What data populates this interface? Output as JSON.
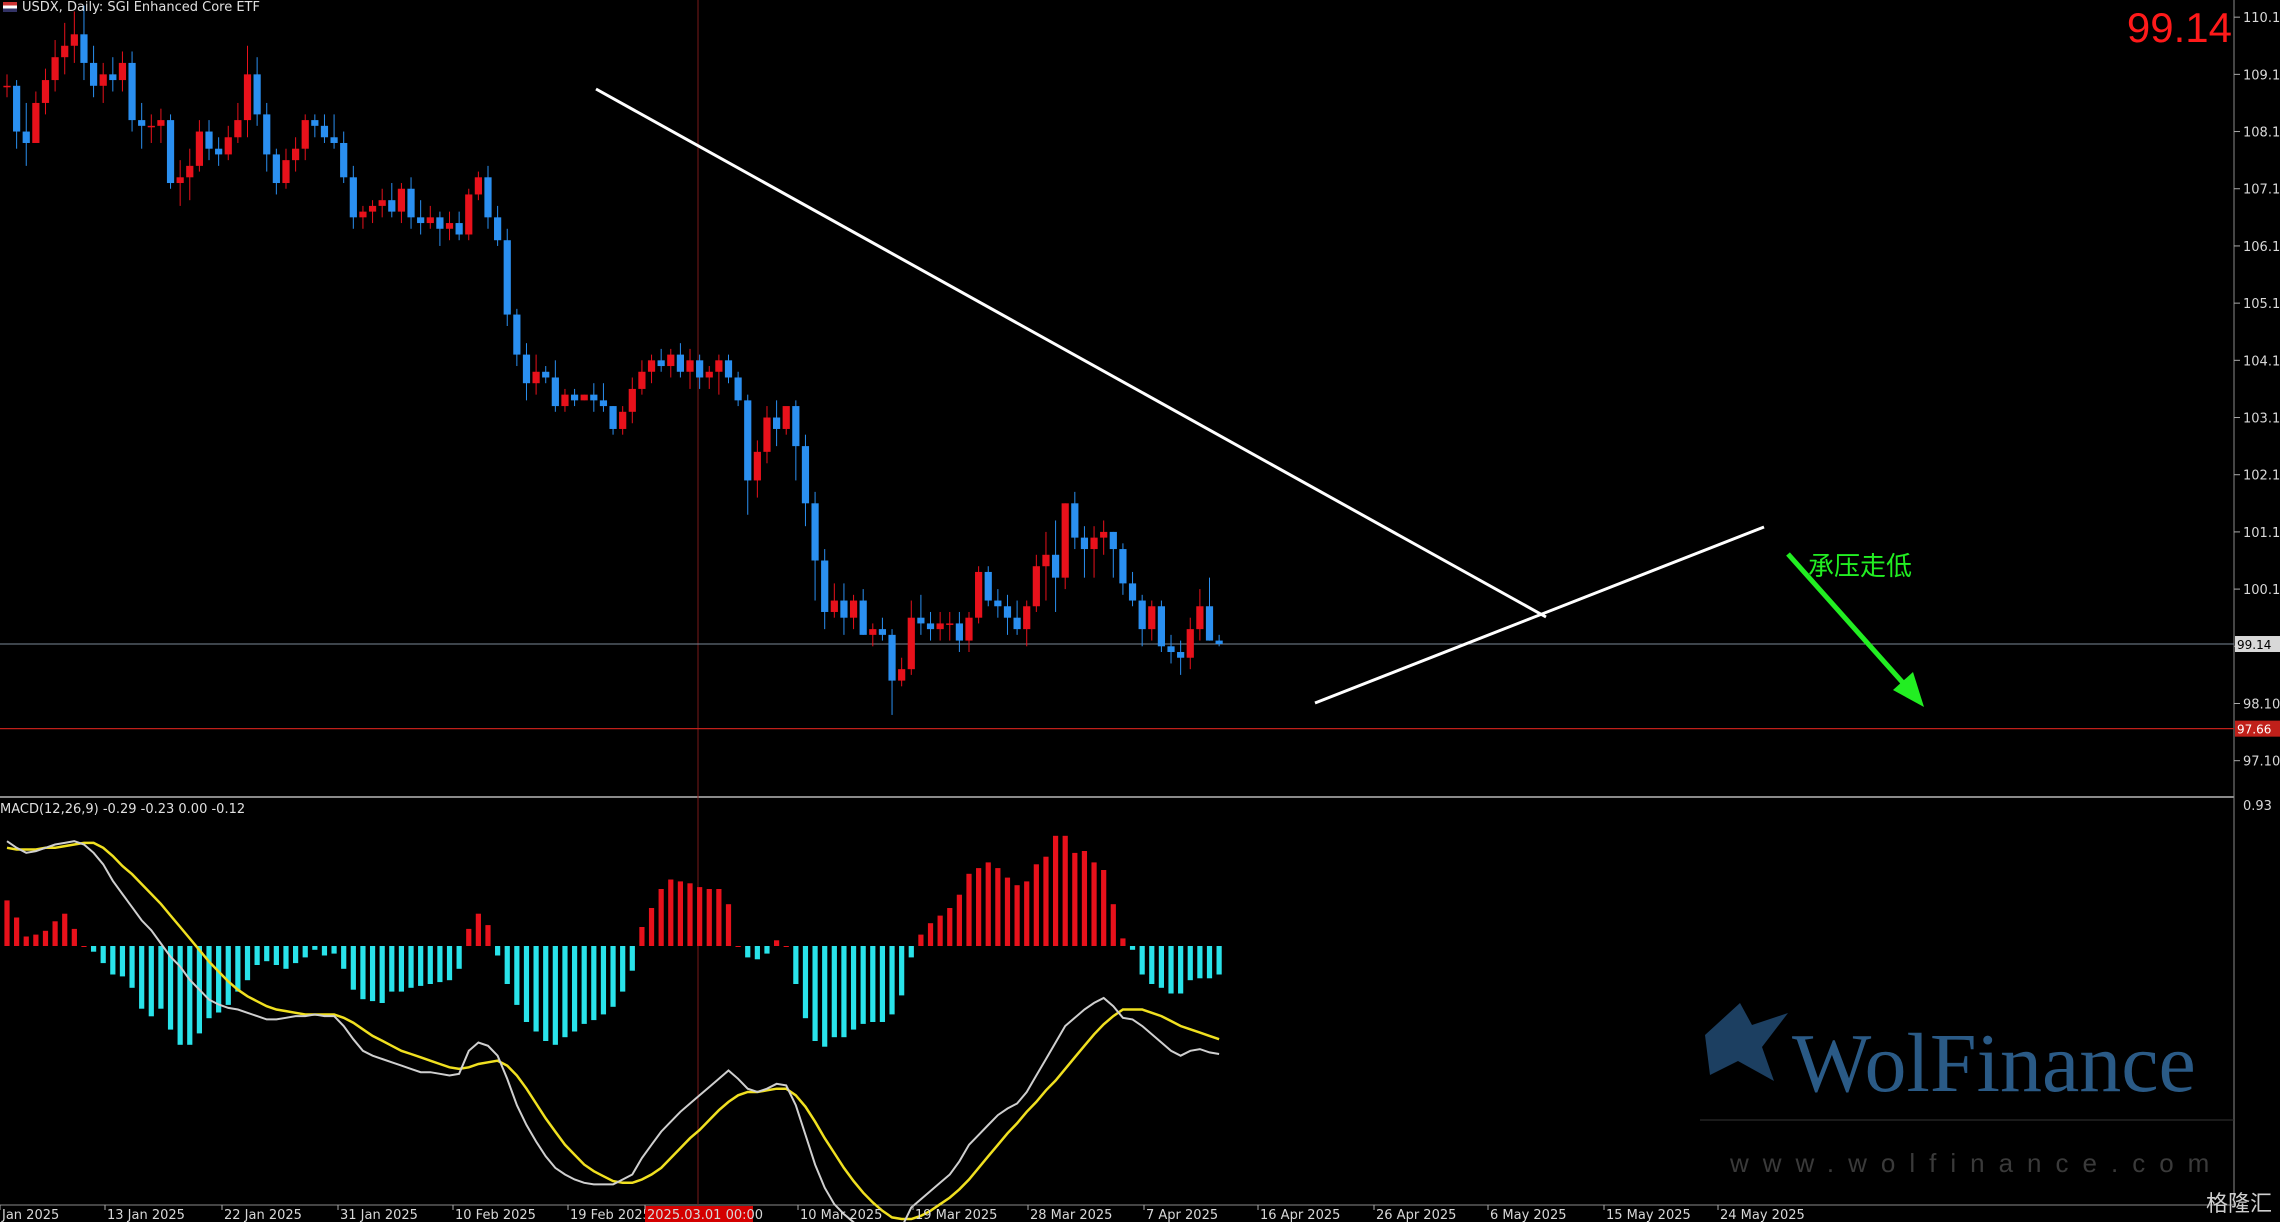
{
  "header": {
    "symbol_line": "USDX, Daily:  SGI Enhanced Core ETF",
    "current_price_big": "99.14",
    "macd_label": "MACD(12,26,9) -0.29 -0.23 0.00 -0.12",
    "macd_top_tick": "0.93"
  },
  "annotation": {
    "text": "承压走低",
    "color": "#22ee22"
  },
  "watermark": {
    "brand": "WolFinance",
    "url": "www.wolfinance.com"
  },
  "corner_brand": "格隆汇",
  "colors": {
    "up": "#e8111b",
    "down": "#2a8ff0",
    "hist_pos": "#e8111b",
    "hist_neg": "#29e3ea",
    "macd_line": "#cfcfcf",
    "signal_line": "#f0e020",
    "trendline": "#ffffff",
    "support_line": "#c0201a",
    "price_line": "#7a8796"
  },
  "chart_data": {
    "type": "candlestick",
    "y_ticks": [
      "110.10",
      "109.10",
      "108.10",
      "107.10",
      "106.10",
      "105.10",
      "104.10",
      "103.10",
      "102.10",
      "101.10",
      "100.10",
      "99.10",
      "98.10",
      "97.10"
    ],
    "price_tag": "99.14",
    "support_tag": "97.66",
    "support_level": 97.66,
    "ylim": [
      96.5,
      110.4
    ],
    "x_labels": [
      "Jan 2025",
      "13 Jan 2025",
      "22 Jan 2025",
      "31 Jan 2025",
      "10 Feb 2025",
      "19 Feb 2025",
      "2025.03.01 00:00",
      "10 Mar 2025",
      "19 Mar 2025",
      "28 Mar 2025",
      "7 Apr 2025",
      "16 Apr 2025",
      "26 Apr 2025",
      "6 May 2025",
      "15 May 2025",
      "24 May 2025"
    ],
    "candles": [
      [
        108.9,
        109.1,
        108.7,
        108.9
      ],
      [
        108.9,
        109.0,
        107.8,
        108.1
      ],
      [
        108.1,
        108.6,
        107.5,
        107.9
      ],
      [
        107.9,
        108.8,
        107.9,
        108.6
      ],
      [
        108.6,
        109.2,
        108.4,
        109.0
      ],
      [
        109.0,
        109.7,
        108.8,
        109.4
      ],
      [
        109.4,
        110.0,
        109.1,
        109.6
      ],
      [
        109.6,
        110.2,
        109.3,
        109.8
      ],
      [
        109.8,
        110.3,
        109.0,
        109.3
      ],
      [
        109.3,
        109.6,
        108.7,
        108.9
      ],
      [
        108.9,
        109.3,
        108.6,
        109.1
      ],
      [
        109.1,
        109.4,
        108.8,
        109.0
      ],
      [
        109.0,
        109.5,
        108.8,
        109.3
      ],
      [
        109.3,
        109.5,
        108.1,
        108.3
      ],
      [
        108.3,
        108.6,
        107.8,
        108.2
      ],
      [
        108.2,
        108.4,
        107.9,
        108.2
      ],
      [
        108.2,
        108.5,
        107.9,
        108.3
      ],
      [
        108.3,
        108.4,
        107.1,
        107.2
      ],
      [
        107.2,
        107.6,
        106.8,
        107.3
      ],
      [
        107.3,
        107.8,
        106.9,
        107.5
      ],
      [
        107.5,
        108.3,
        107.4,
        108.1
      ],
      [
        108.1,
        108.3,
        107.6,
        107.8
      ],
      [
        107.8,
        108.0,
        107.5,
        107.7
      ],
      [
        107.7,
        108.2,
        107.6,
        108.0
      ],
      [
        108.0,
        108.6,
        107.9,
        108.3
      ],
      [
        108.3,
        109.6,
        108.0,
        109.1
      ],
      [
        109.1,
        109.4,
        108.2,
        108.4
      ],
      [
        108.4,
        108.6,
        107.4,
        107.7
      ],
      [
        107.7,
        107.8,
        107.0,
        107.2
      ],
      [
        107.2,
        107.8,
        107.1,
        107.6
      ],
      [
        107.6,
        108.0,
        107.4,
        107.8
      ],
      [
        107.8,
        108.4,
        107.6,
        108.3
      ],
      [
        108.3,
        108.4,
        108.0,
        108.2
      ],
      [
        108.2,
        108.4,
        107.9,
        108.0
      ],
      [
        108.0,
        108.4,
        107.8,
        107.9
      ],
      [
        107.9,
        108.1,
        107.2,
        107.3
      ],
      [
        107.3,
        107.5,
        106.4,
        106.6
      ],
      [
        106.6,
        106.8,
        106.4,
        106.7
      ],
      [
        106.7,
        106.9,
        106.5,
        106.8
      ],
      [
        106.8,
        107.1,
        106.6,
        106.9
      ],
      [
        106.9,
        107.2,
        106.6,
        106.7
      ],
      [
        106.7,
        107.2,
        106.5,
        107.1
      ],
      [
        107.1,
        107.3,
        106.4,
        106.6
      ],
      [
        106.6,
        106.9,
        106.3,
        106.5
      ],
      [
        106.5,
        106.8,
        106.4,
        106.6
      ],
      [
        106.6,
        106.7,
        106.1,
        106.4
      ],
      [
        106.4,
        106.7,
        106.2,
        106.5
      ],
      [
        106.5,
        106.7,
        106.2,
        106.3
      ],
      [
        106.3,
        107.1,
        106.2,
        107.0
      ],
      [
        107.0,
        107.4,
        106.9,
        107.3
      ],
      [
        107.3,
        107.5,
        106.4,
        106.6
      ],
      [
        106.6,
        106.8,
        106.1,
        106.2
      ],
      [
        106.2,
        106.4,
        104.7,
        104.9
      ],
      [
        104.9,
        105.0,
        104.0,
        104.2
      ],
      [
        104.2,
        104.4,
        103.4,
        103.7
      ],
      [
        103.7,
        104.2,
        103.5,
        103.9
      ],
      [
        103.9,
        104.0,
        103.7,
        103.8
      ],
      [
        103.8,
        104.1,
        103.2,
        103.3
      ],
      [
        103.3,
        103.6,
        103.2,
        103.5
      ],
      [
        103.5,
        103.6,
        103.3,
        103.4
      ],
      [
        103.4,
        103.5,
        103.4,
        103.5
      ],
      [
        103.5,
        103.7,
        103.2,
        103.4
      ],
      [
        103.4,
        103.7,
        103.2,
        103.3
      ],
      [
        103.3,
        103.3,
        102.8,
        102.9
      ],
      [
        102.9,
        103.3,
        102.8,
        103.2
      ],
      [
        103.2,
        103.8,
        103.0,
        103.6
      ],
      [
        103.6,
        104.1,
        103.5,
        103.9
      ],
      [
        103.9,
        104.2,
        103.7,
        104.1
      ],
      [
        104.1,
        104.3,
        103.9,
        104.0
      ],
      [
        104.0,
        104.3,
        103.8,
        104.2
      ],
      [
        104.2,
        104.4,
        103.8,
        103.9
      ],
      [
        103.9,
        104.3,
        103.6,
        104.1
      ],
      [
        104.1,
        104.2,
        103.6,
        103.8
      ],
      [
        103.8,
        104.0,
        103.6,
        103.9
      ],
      [
        103.9,
        104.2,
        103.5,
        104.1
      ],
      [
        104.1,
        104.2,
        103.7,
        103.8
      ],
      [
        103.8,
        103.9,
        103.3,
        103.4
      ],
      [
        103.4,
        103.5,
        101.4,
        102.0
      ],
      [
        102.0,
        102.7,
        101.7,
        102.5
      ],
      [
        102.5,
        103.3,
        102.3,
        103.1
      ],
      [
        103.1,
        103.4,
        102.6,
        102.9
      ],
      [
        102.9,
        103.2,
        102.8,
        103.3
      ],
      [
        103.3,
        103.4,
        102.0,
        102.6
      ],
      [
        102.6,
        102.8,
        101.2,
        101.6
      ],
      [
        101.6,
        101.8,
        99.9,
        100.6
      ],
      [
        100.6,
        100.8,
        99.4,
        99.7
      ],
      [
        99.7,
        100.2,
        99.6,
        99.9
      ],
      [
        99.9,
        100.2,
        99.3,
        99.6
      ],
      [
        99.6,
        100.0,
        99.4,
        99.9
      ],
      [
        99.9,
        100.1,
        99.3,
        99.3
      ],
      [
        99.3,
        99.5,
        99.1,
        99.4
      ],
      [
        99.4,
        99.6,
        99.2,
        99.3
      ],
      [
        99.3,
        99.4,
        97.9,
        98.5
      ],
      [
        98.5,
        98.9,
        98.4,
        98.7
      ],
      [
        98.7,
        99.9,
        98.6,
        99.6
      ],
      [
        99.6,
        100.0,
        99.3,
        99.5
      ],
      [
        99.5,
        99.7,
        99.2,
        99.4
      ],
      [
        99.4,
        99.7,
        99.2,
        99.5
      ],
      [
        99.5,
        99.7,
        99.2,
        99.5
      ],
      [
        99.5,
        99.7,
        99.0,
        99.2
      ],
      [
        99.2,
        99.7,
        99.0,
        99.6
      ],
      [
        99.6,
        100.5,
        99.5,
        100.4
      ],
      [
        100.4,
        100.5,
        99.8,
        99.9
      ],
      [
        99.9,
        100.1,
        99.6,
        99.8
      ],
      [
        99.8,
        100.0,
        99.3,
        99.6
      ],
      [
        99.6,
        99.9,
        99.3,
        99.4
      ],
      [
        99.4,
        99.9,
        99.1,
        99.8
      ],
      [
        99.8,
        100.7,
        99.7,
        100.5
      ],
      [
        100.5,
        101.1,
        99.9,
        100.7
      ],
      [
        100.7,
        101.3,
        99.7,
        100.3
      ],
      [
        100.3,
        101.6,
        100.1,
        101.6
      ],
      [
        101.6,
        101.8,
        100.8,
        101.0
      ],
      [
        101.0,
        101.2,
        100.3,
        100.8
      ],
      [
        100.8,
        101.2,
        100.3,
        101.0
      ],
      [
        101.0,
        101.3,
        100.7,
        101.1
      ],
      [
        101.1,
        101.1,
        100.3,
        100.8
      ],
      [
        100.8,
        100.9,
        100.0,
        100.2
      ],
      [
        100.2,
        100.4,
        99.8,
        99.9
      ],
      [
        99.9,
        100.0,
        99.1,
        99.4
      ],
      [
        99.4,
        99.9,
        99.2,
        99.8
      ],
      [
        99.8,
        99.9,
        99.0,
        99.1
      ],
      [
        99.1,
        99.3,
        98.8,
        99.0
      ],
      [
        99.0,
        99.2,
        98.6,
        98.9
      ],
      [
        98.9,
        99.6,
        98.7,
        99.4
      ],
      [
        99.4,
        100.1,
        99.2,
        99.8
      ],
      [
        99.8,
        100.3,
        99.2,
        99.2
      ],
      [
        99.2,
        99.3,
        99.1,
        99.14
      ]
    ],
    "macd_hist": [
      0.24,
      0.15,
      0.05,
      0.06,
      0.08,
      0.13,
      0.17,
      0.09,
      0.0,
      -0.03,
      -0.09,
      -0.15,
      -0.16,
      -0.22,
      -0.33,
      -0.37,
      -0.33,
      -0.44,
      -0.52,
      -0.52,
      -0.46,
      -0.38,
      -0.35,
      -0.31,
      -0.24,
      -0.18,
      -0.1,
      -0.08,
      -0.1,
      -0.12,
      -0.09,
      -0.06,
      -0.02,
      -0.05,
      -0.04,
      -0.12,
      -0.23,
      -0.28,
      -0.29,
      -0.3,
      -0.24,
      -0.24,
      -0.22,
      -0.21,
      -0.2,
      -0.19,
      -0.18,
      -0.12,
      0.09,
      0.17,
      0.11,
      -0.05,
      -0.2,
      -0.31,
      -0.4,
      -0.45,
      -0.5,
      -0.52,
      -0.48,
      -0.45,
      -0.41,
      -0.39,
      -0.36,
      -0.32,
      -0.24,
      -0.13,
      0.1,
      0.2,
      0.3,
      0.35,
      0.34,
      0.33,
      0.31,
      0.3,
      0.3,
      0.22,
      0.0,
      -0.06,
      -0.07,
      -0.04,
      0.03,
      0.0,
      -0.2,
      -0.38,
      -0.5,
      -0.53,
      -0.48,
      -0.48,
      -0.44,
      -0.41,
      -0.4,
      -0.4,
      -0.36,
      -0.26,
      -0.06,
      0.06,
      0.12,
      0.16,
      0.2,
      0.27,
      0.38,
      0.41,
      0.44,
      0.41,
      0.36,
      0.32,
      0.34,
      0.43,
      0.47,
      0.58,
      0.58,
      0.49,
      0.5,
      0.44,
      0.4,
      0.22,
      0.04,
      -0.02,
      -0.15,
      -0.2,
      -0.22,
      -0.25,
      -0.25,
      -0.18,
      -0.17,
      -0.17,
      -0.15
    ],
    "macd_line": [
      0.92,
      0.88,
      0.85,
      0.86,
      0.88,
      0.9,
      0.91,
      0.92,
      0.9,
      0.85,
      0.78,
      0.68,
      0.6,
      0.52,
      0.44,
      0.38,
      0.3,
      0.22,
      0.16,
      0.08,
      0.02,
      -0.04,
      -0.07,
      -0.09,
      -0.1,
      -0.12,
      -0.14,
      -0.16,
      -0.16,
      -0.15,
      -0.14,
      -0.14,
      -0.13,
      -0.14,
      -0.14,
      -0.2,
      -0.28,
      -0.35,
      -0.38,
      -0.4,
      -0.42,
      -0.44,
      -0.46,
      -0.48,
      -0.48,
      -0.49,
      -0.5,
      -0.49,
      -0.35,
      -0.3,
      -0.32,
      -0.38,
      -0.52,
      -0.68,
      -0.8,
      -0.9,
      -0.99,
      -1.06,
      -1.1,
      -1.13,
      -1.15,
      -1.16,
      -1.16,
      -1.16,
      -1.13,
      -1.1,
      -1.0,
      -0.92,
      -0.84,
      -0.78,
      -0.72,
      -0.67,
      -0.62,
      -0.57,
      -0.52,
      -0.47,
      -0.52,
      -0.58,
      -0.6,
      -0.58,
      -0.55,
      -0.56,
      -0.68,
      -0.86,
      -1.04,
      -1.18,
      -1.28,
      -1.34,
      -1.39,
      -1.43,
      -1.46,
      -1.49,
      -1.47,
      -1.42,
      -1.3,
      -1.25,
      -1.2,
      -1.15,
      -1.1,
      -1.02,
      -0.92,
      -0.86,
      -0.8,
      -0.74,
      -0.7,
      -0.67,
      -0.6,
      -0.5,
      -0.4,
      -0.3,
      -0.2,
      -0.15,
      -0.1,
      -0.06,
      -0.03,
      -0.08,
      -0.15,
      -0.16,
      -0.2,
      -0.25,
      -0.3,
      -0.35,
      -0.38,
      -0.35,
      -0.34,
      -0.36,
      -0.37
    ],
    "signal_line": [
      0.88,
      0.87,
      0.87,
      0.87,
      0.88,
      0.88,
      0.89,
      0.9,
      0.91,
      0.91,
      0.88,
      0.83,
      0.77,
      0.72,
      0.66,
      0.6,
      0.54,
      0.47,
      0.4,
      0.33,
      0.26,
      0.19,
      0.13,
      0.07,
      0.02,
      -0.02,
      -0.05,
      -0.08,
      -0.1,
      -0.11,
      -0.12,
      -0.13,
      -0.13,
      -0.13,
      -0.13,
      -0.15,
      -0.18,
      -0.22,
      -0.26,
      -0.29,
      -0.32,
      -0.35,
      -0.37,
      -0.39,
      -0.41,
      -0.43,
      -0.45,
      -0.46,
      -0.45,
      -0.43,
      -0.42,
      -0.41,
      -0.44,
      -0.5,
      -0.58,
      -0.67,
      -0.76,
      -0.84,
      -0.92,
      -0.98,
      -1.04,
      -1.08,
      -1.11,
      -1.14,
      -1.15,
      -1.15,
      -1.13,
      -1.1,
      -1.06,
      -1.0,
      -0.94,
      -0.88,
      -0.83,
      -0.77,
      -0.71,
      -0.66,
      -0.62,
      -0.6,
      -0.6,
      -0.59,
      -0.58,
      -0.58,
      -0.62,
      -0.69,
      -0.78,
      -0.88,
      -0.97,
      -1.06,
      -1.14,
      -1.21,
      -1.27,
      -1.32,
      -1.36,
      -1.37,
      -1.37,
      -1.35,
      -1.32,
      -1.28,
      -1.24,
      -1.19,
      -1.13,
      -1.06,
      -0.99,
      -0.92,
      -0.85,
      -0.79,
      -0.72,
      -0.66,
      -0.59,
      -0.53,
      -0.46,
      -0.39,
      -0.32,
      -0.25,
      -0.19,
      -0.14,
      -0.1,
      -0.1,
      -0.1,
      -0.12,
      -0.14,
      -0.17,
      -0.2,
      -0.22,
      -0.24,
      -0.26,
      -0.28
    ]
  }
}
